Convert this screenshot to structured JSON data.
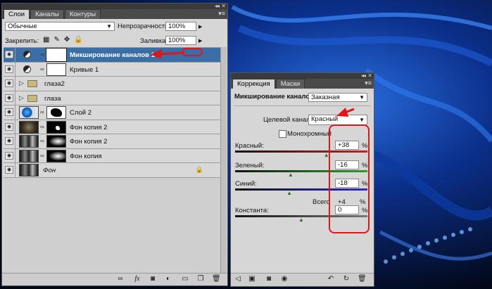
{
  "layers_panel": {
    "tabs": [
      "Слои",
      "Каналы",
      "Контуры"
    ],
    "active_tab": 0,
    "blend_mode": "Обычные",
    "opacity_label": "Непрозрачность:",
    "opacity_value": "100%",
    "lock_label": "Закрепить:",
    "fill_label": "Заливка:",
    "fill_value": "100%",
    "layers": [
      {
        "name": "Микширование каналов 1",
        "kind": "adjustment",
        "selected": true
      },
      {
        "name": "Кривые 1",
        "kind": "adjustment",
        "selected": false
      },
      {
        "name": "глаза2",
        "kind": "group",
        "selected": false
      },
      {
        "name": "глаза",
        "kind": "group",
        "selected": false
      },
      {
        "name": "Слой 2",
        "kind": "image-mask",
        "selected": false
      },
      {
        "name": "Фон копия 2",
        "kind": "image-mask",
        "selected": false
      },
      {
        "name": "Фон копия 2",
        "kind": "image-mask",
        "selected": false
      },
      {
        "name": "Фон копия",
        "kind": "image-mask",
        "selected": false
      },
      {
        "name": "Фон",
        "kind": "background",
        "selected": false
      }
    ],
    "bottom_icons": [
      "link-icon",
      "fx-icon",
      "mask-icon",
      "adjustment-icon",
      "folder-icon",
      "new-layer-icon",
      "trash-icon"
    ]
  },
  "correction_panel": {
    "tabs": [
      "Коррекция",
      "Маски"
    ],
    "active_tab": 0,
    "title": "Микширование каналов",
    "preset": "Заказная",
    "target_label": "Целевой канал:",
    "target_value": "Красный",
    "monochrome_label": "Монохромный",
    "channels": [
      {
        "label": "Красный:",
        "value": "+38",
        "unit": "%",
        "color": "#c8202a",
        "level": 0.69
      },
      {
        "label": "Зеленый:",
        "value": "-16",
        "unit": "%",
        "color": "#2aa02a",
        "level": 0.42
      },
      {
        "label": "Синий:",
        "value": "-18",
        "unit": "%",
        "color": "#2a2ac8",
        "level": 0.41
      },
      {
        "label": "Константа:",
        "value": "0",
        "unit": "%",
        "color": "#777777",
        "level": 0.5
      }
    ],
    "total_label": "Всего",
    "total_value": "+4",
    "total_unit": "%",
    "bottom_icons": [
      "back-icon",
      "clip-icon",
      "visibility-icon",
      "eye-icon",
      "previous-state-icon",
      "reset-icon",
      "trash-icon"
    ]
  },
  "colors": {
    "annotation_red": "#e0161b",
    "selected_layer": "#3a6ea5",
    "panel_bg": "#d6d6d6"
  }
}
